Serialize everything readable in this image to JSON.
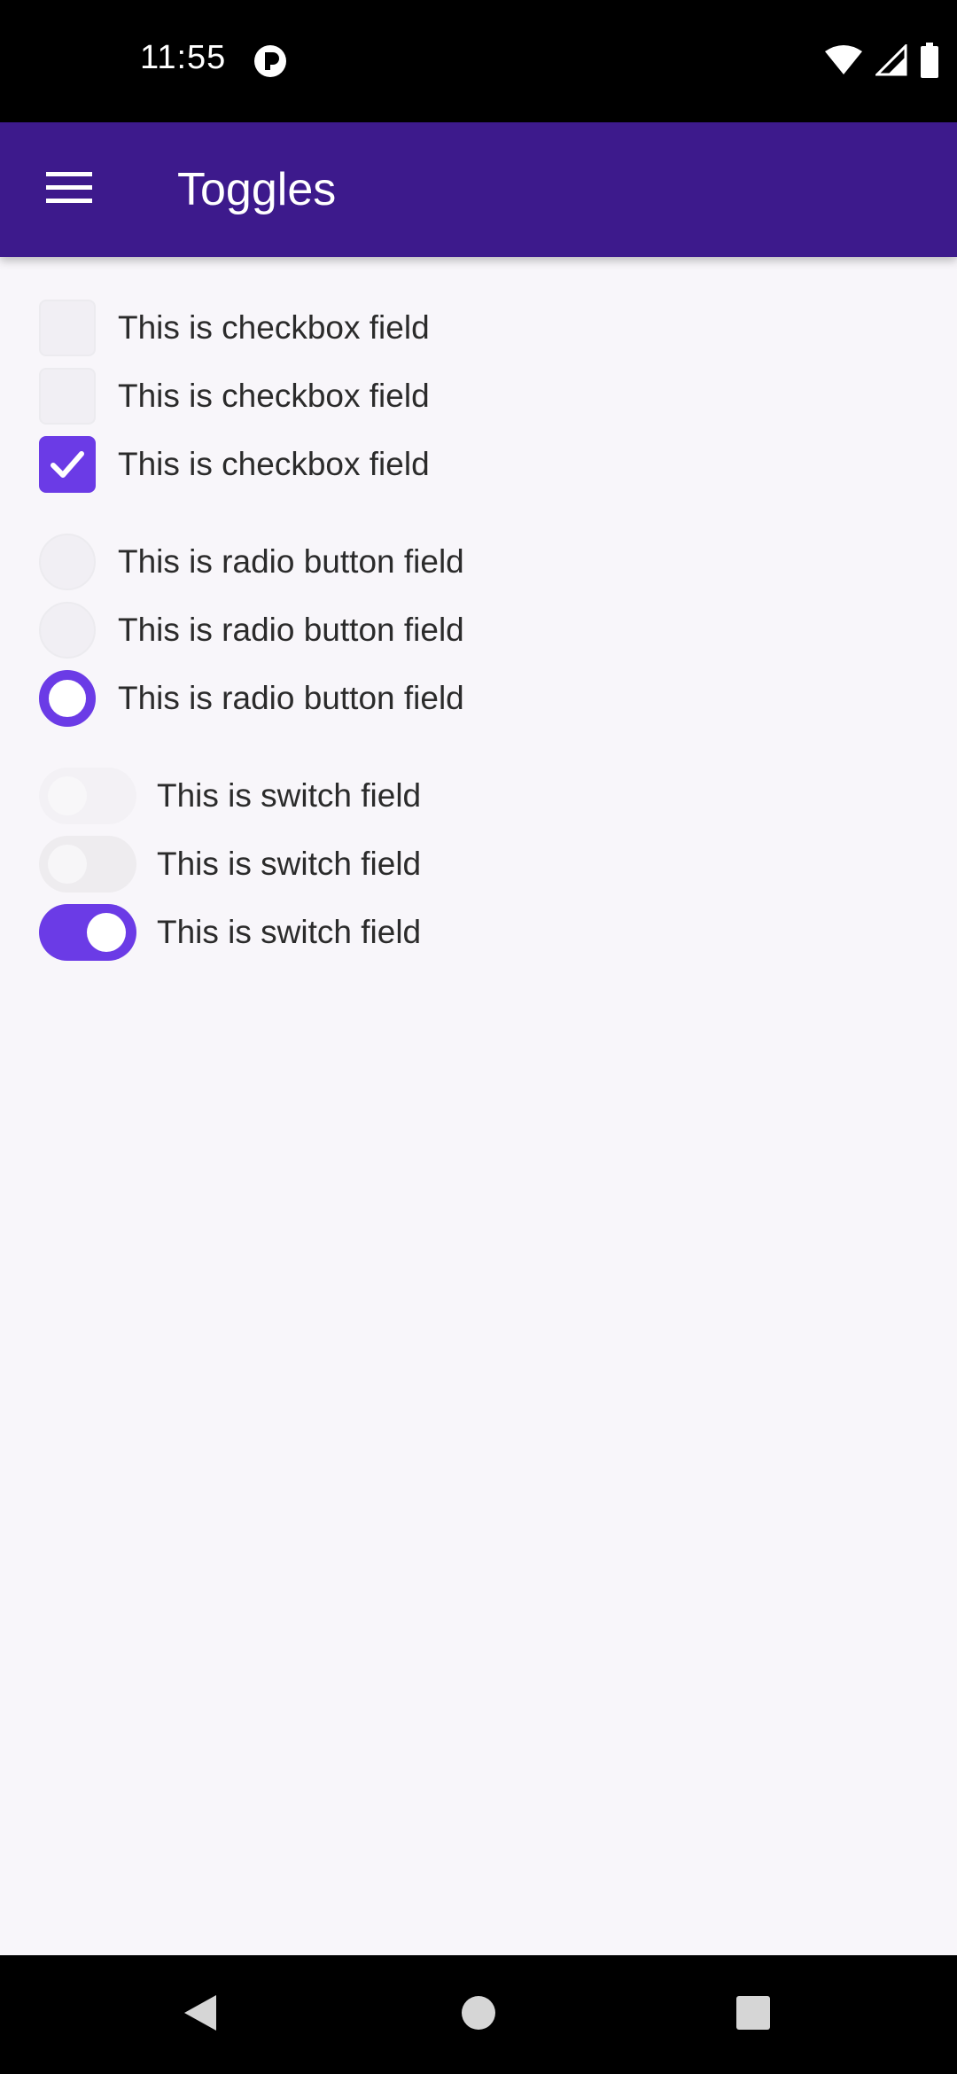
{
  "status_bar": {
    "time": "11:55",
    "icons": [
      "app-indicator-icon",
      "wifi-icon",
      "cellular-signal-icon",
      "battery-icon"
    ]
  },
  "app_bar": {
    "title": "Toggles",
    "menu_icon": "hamburger-menu-icon",
    "background": "#3d1a8c"
  },
  "accent_color": "#6b3be6",
  "checkboxes": [
    {
      "label": "This is checkbox field",
      "checked": false
    },
    {
      "label": "This is checkbox field",
      "checked": false
    },
    {
      "label": "This is checkbox field",
      "checked": true
    }
  ],
  "radios": [
    {
      "label": "This is radio button field",
      "selected": false
    },
    {
      "label": "This is radio button field",
      "selected": false
    },
    {
      "label": "This is radio button field",
      "selected": true
    }
  ],
  "switches": [
    {
      "label": "This is switch field",
      "on": false
    },
    {
      "label": "This is switch field",
      "on": false
    },
    {
      "label": "This is switch field",
      "on": true
    }
  ],
  "nav_bar": {
    "icons": [
      "back-icon",
      "home-icon",
      "recents-icon"
    ]
  }
}
